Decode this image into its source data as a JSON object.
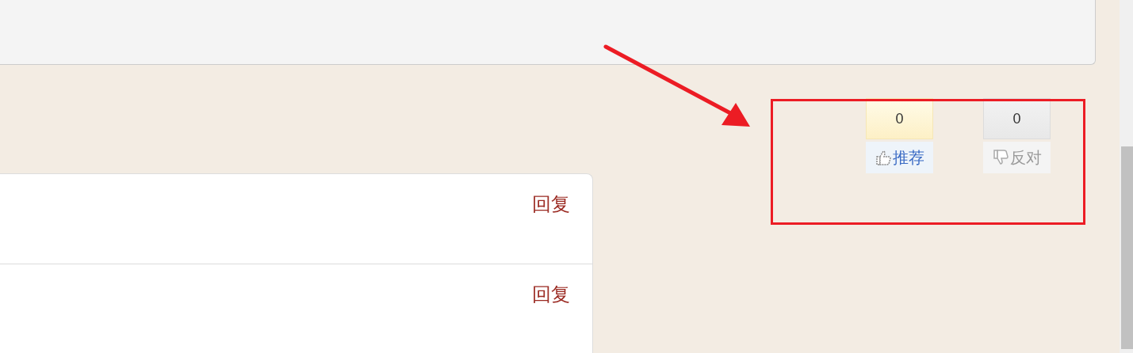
{
  "votes": [
    {
      "kind": "up",
      "count": "0",
      "label": "推荐"
    },
    {
      "kind": "down",
      "count": "0",
      "label": "反对"
    }
  ],
  "comments": [
    {
      "reply": "回复"
    },
    {
      "reply": "回复"
    }
  ]
}
